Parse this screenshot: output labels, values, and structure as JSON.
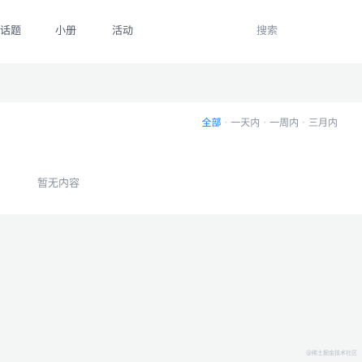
{
  "nav": {
    "items": [
      {
        "label": "话题"
      },
      {
        "label": "小册"
      },
      {
        "label": "活动"
      }
    ],
    "search_label": "搜索"
  },
  "filters": {
    "options": [
      {
        "label": "全部",
        "active": true
      },
      {
        "label": "一天内",
        "active": false
      },
      {
        "label": "一周内",
        "active": false
      },
      {
        "label": "三月内",
        "active": false
      }
    ],
    "separator": "·"
  },
  "content": {
    "empty_text": "暂无内容"
  },
  "watermark": "@稀土掘金技术社区",
  "colors": {
    "accent": "#1e80ff",
    "text_secondary": "#8a919f",
    "text_primary": "#515767",
    "page_bg": "#f4f5f5",
    "panel_bg": "#ffffff"
  }
}
